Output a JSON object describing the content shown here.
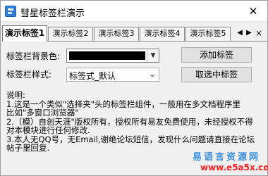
{
  "window": {
    "title": "彗星标签栏演示",
    "icons": {
      "app": "app-icon",
      "close": "close-icon"
    }
  },
  "tabs": {
    "items": [
      {
        "label": "演示标签1",
        "active": true
      },
      {
        "label": "演示标签2",
        "active": false
      },
      {
        "label": "演示标签3",
        "active": false
      },
      {
        "label": "演示标签4",
        "active": false
      },
      {
        "label": "演示标签5",
        "active": false
      }
    ],
    "nav_prev": "◀",
    "nav_next": "▶",
    "close": "×"
  },
  "form": {
    "bg_label": "标签栏背景色:",
    "bg_color": "#000000",
    "style_label": "标签栏样式:",
    "style_value": "标签式_默认",
    "add_button": "添加标签",
    "remove_button": "取选中标签"
  },
  "description": {
    "lines": [
      "说明:",
      "1.这是一个类似\"选择夹\"头的标签栏组件，一般用在多文档程序里",
      "比如\"多窗口浏览器\"",
      "2.（模）自创天涯\"版权所有，授权所有易友免费使用，未经授权不得",
      "对本模块进行任何修改.",
      "3.本人无QQ号，无Email,谢绝论坛短信，发现什么问题请直接在论坛",
      "帖子里回复."
    ]
  },
  "watermark": {
    "cn": "易语言资源网",
    "url": "www.e5a5x.com"
  }
}
